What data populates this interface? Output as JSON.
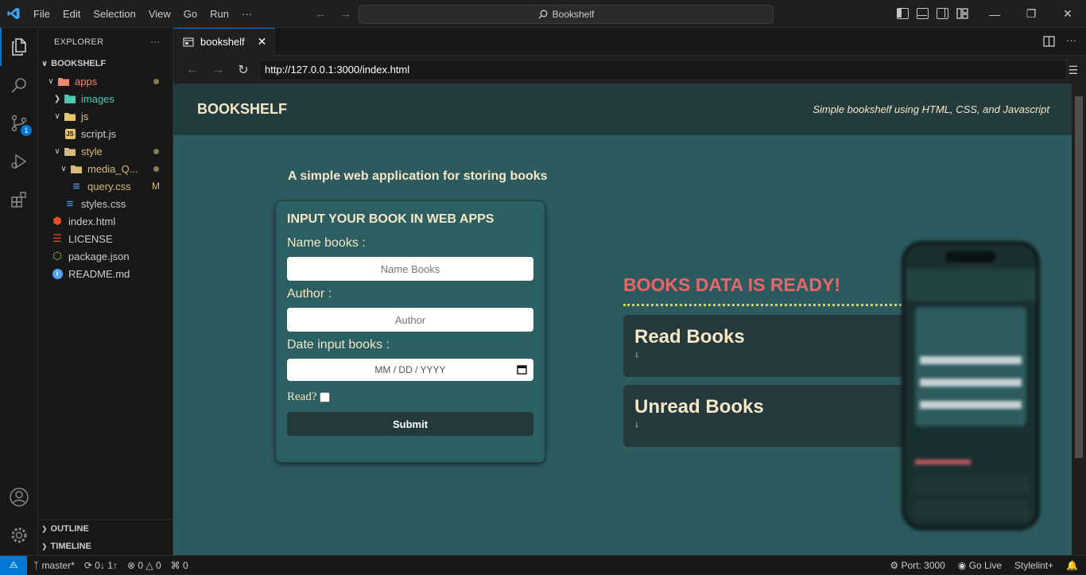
{
  "titlebar": {
    "menu": [
      "File",
      "Edit",
      "Selection",
      "View",
      "Go",
      "Run",
      "···"
    ],
    "search_text": "Bookshelf",
    "window_controls": [
      "minimize",
      "restore",
      "close"
    ]
  },
  "activitybar": {
    "items": [
      "explorer-icon",
      "search-icon",
      "source-control-icon",
      "run-debug-icon",
      "extensions-icon"
    ],
    "scm_badge": "1",
    "bottom": [
      "account-icon",
      "manage-gear-icon"
    ]
  },
  "explorer": {
    "header": "EXPLORER",
    "more": "···",
    "root": "BOOKSHELF",
    "tree": [
      {
        "label": "apps",
        "depth": 1,
        "kind": "folder-open",
        "color": "#f48771",
        "dot": true
      },
      {
        "label": "images",
        "depth": 2,
        "kind": "folder-closed",
        "color": "#4ec9b0"
      },
      {
        "label": "js",
        "depth": 2,
        "kind": "folder-open",
        "color": "#e8c56d"
      },
      {
        "label": "script.js",
        "depth": 3,
        "kind": "js"
      },
      {
        "label": "style",
        "depth": 2,
        "kind": "folder-open",
        "color": "#d7ba7d",
        "dot": true
      },
      {
        "label": "media_Q...",
        "depth": 3,
        "kind": "folder-open",
        "color": "#d7ba7d",
        "dot": true
      },
      {
        "label": "query.css",
        "depth": 4,
        "kind": "css",
        "color": "#d7ba7d",
        "flag": "M"
      },
      {
        "label": "styles.css",
        "depth": 3,
        "kind": "css"
      },
      {
        "label": "index.html",
        "depth": 1,
        "kind": "html"
      },
      {
        "label": "LICENSE",
        "depth": 1,
        "kind": "license"
      },
      {
        "label": "package.json",
        "depth": 1,
        "kind": "npm"
      },
      {
        "label": "README.md",
        "depth": 1,
        "kind": "info"
      }
    ],
    "outline": "OUTLINE",
    "timeline": "TIMELINE"
  },
  "editor": {
    "tab_label": "bookshelf",
    "url": "http://127.0.0.1:3000/index.html"
  },
  "web": {
    "brand": "BOOKSHELF",
    "tagline": "Simple bookshelf using HTML, CSS, and Javascript",
    "subtitle": "A simple web application for storing books",
    "form": {
      "title": "INPUT YOUR BOOK IN WEB APPS",
      "name_label": "Name books :",
      "name_placeholder": "Name Books",
      "author_label": "Author :",
      "author_placeholder": "Author",
      "date_label": "Date input books :",
      "date_placeholder": "MM / DD / YYYY",
      "read_label": "Read?",
      "submit": "Submit"
    },
    "ready_title": "BOOKS DATA IS READY!",
    "shelves": [
      {
        "title": "Read Books",
        "arrow": "↓"
      },
      {
        "title": "Unread Books",
        "arrow": "↓"
      }
    ]
  },
  "statusbar": {
    "branch": "master*",
    "sync": "0↓ 1↑",
    "problems": "0",
    "warnings": "0",
    "ports": "0",
    "port": "Port: 3000",
    "golive": "Go Live",
    "stylelint": "Stylelint+"
  },
  "colors": {
    "accent": "#0078d4",
    "web_bg": "#2c5a5e",
    "cream": "#f5e7c6",
    "ready": "#e8656a"
  }
}
